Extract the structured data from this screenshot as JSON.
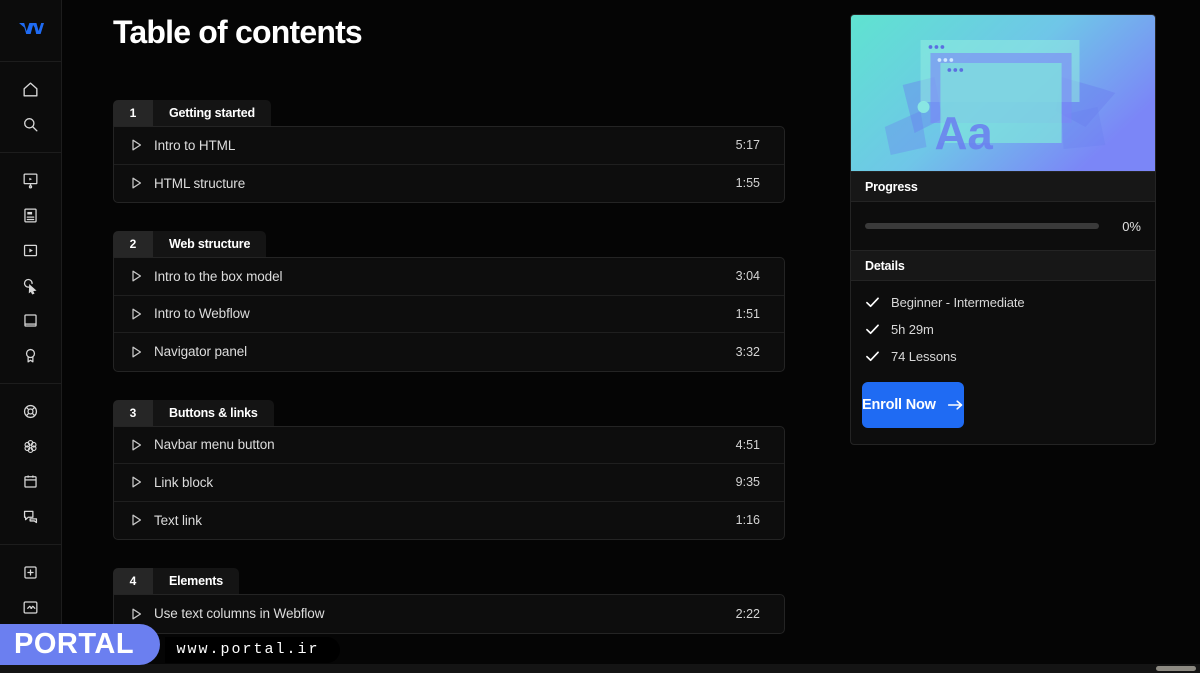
{
  "page": {
    "title": "Table of contents",
    "accent_blue": "#1f6bf3",
    "bg": "#050505"
  },
  "sidebar": {
    "logo": {
      "name": "webflow-logo",
      "color": "#1f6bf3"
    },
    "groups": [
      {
        "items": [
          {
            "icon": "home-icon",
            "label": "Home"
          },
          {
            "icon": "search-icon",
            "label": "Search"
          }
        ]
      },
      {
        "items": [
          {
            "icon": "presentation-icon",
            "label": "Courses"
          },
          {
            "icon": "article-icon",
            "label": "Articles"
          },
          {
            "icon": "video-icon",
            "label": "Videos"
          },
          {
            "icon": "cursor-click-icon",
            "label": "Interactions"
          },
          {
            "icon": "book-icon",
            "label": "Library"
          },
          {
            "icon": "award-icon",
            "label": "Certifications"
          }
        ]
      },
      {
        "items": [
          {
            "icon": "lifebuoy-icon",
            "label": "Help"
          },
          {
            "icon": "flower-icon",
            "label": "Community"
          },
          {
            "icon": "calendar-icon",
            "label": "Events"
          },
          {
            "icon": "chat-icon",
            "label": "Forum"
          }
        ]
      },
      {
        "items": [
          {
            "icon": "plus-box-icon",
            "label": "New"
          }
        ]
      }
    ]
  },
  "toc": {
    "sections": [
      {
        "number": "1",
        "name": "Getting started",
        "lessons": [
          {
            "title": "Intro to HTML",
            "duration": "5:17"
          },
          {
            "title": "HTML structure",
            "duration": "1:55"
          }
        ]
      },
      {
        "number": "2",
        "name": "Web structure",
        "lessons": [
          {
            "title": "Intro to the box model",
            "duration": "3:04"
          },
          {
            "title": "Intro to Webflow",
            "duration": "1:51"
          },
          {
            "title": "Navigator panel",
            "duration": "3:32"
          }
        ]
      },
      {
        "number": "3",
        "name": "Buttons & links",
        "lessons": [
          {
            "title": "Navbar menu button",
            "duration": "4:51"
          },
          {
            "title": "Link block",
            "duration": "9:35"
          },
          {
            "title": "Text link",
            "duration": "1:16"
          }
        ]
      },
      {
        "number": "4",
        "name": "Elements",
        "lessons": [
          {
            "title": "Use text columns in Webflow",
            "duration": "2:22"
          }
        ]
      }
    ]
  },
  "card": {
    "thumbnail": {
      "name": "course-thumbnail",
      "gradient_from": "#5fe3d0",
      "gradient_to": "#7b86f7",
      "label": "Aa"
    },
    "progress_header": "Progress",
    "progress_percent": "0%",
    "progress_value": 0,
    "details_header": "Details",
    "details": [
      {
        "icon": "check-icon",
        "text": "Beginner - Intermediate"
      },
      {
        "icon": "check-icon",
        "text": "5h 29m"
      },
      {
        "icon": "check-icon",
        "text": "74  Lessons"
      }
    ],
    "enroll_label": "Enroll Now",
    "enroll_icon": "arrow-right-icon"
  },
  "watermark": {
    "brand": "PORTAL",
    "url": "www.portal.ir",
    "brand_bg": "#6b7ff0"
  }
}
